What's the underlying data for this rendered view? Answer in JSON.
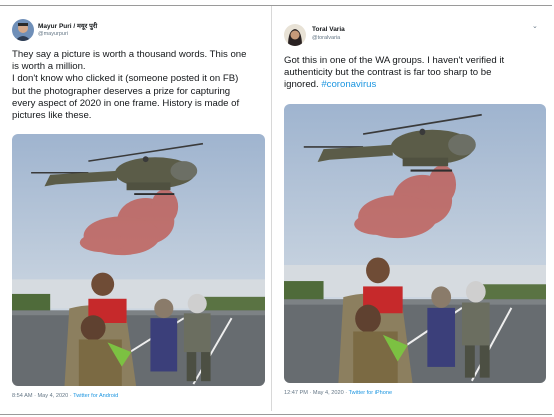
{
  "tweets": [
    {
      "author_name": "Mayur Puri / मयूर पुरी",
      "author_handle": "@mayurpuri",
      "text_lines": [
        "They say a picture is worth a thousand words. This one",
        "is worth a million.",
        "I don't know who clicked it (someone posted it on FB)",
        "but the photographer deserves a prize for capturing",
        "every aspect of 2020 in one frame. History is made of",
        "pictures like these."
      ],
      "timestamp": "8:54 AM · May 4, 2020 · ",
      "source": "Twitter for Android"
    },
    {
      "author_name": "Toral Varia",
      "author_handle": "@toralvaria",
      "text_lines": [
        "Got this in one of the WA groups. I haven't verified it",
        "authenticity but the contrast is far too sharp to be",
        "ignored. "
      ],
      "hashtag": "#coronavirus",
      "timestamp": "12:47 PM · May 4, 2020 · ",
      "source": "Twitter for iPhone"
    }
  ],
  "icons": {
    "menu": "chevron-down-icon"
  },
  "colors": {
    "link": "#1b95e0",
    "text": "#14171a",
    "muted": "#657786"
  }
}
